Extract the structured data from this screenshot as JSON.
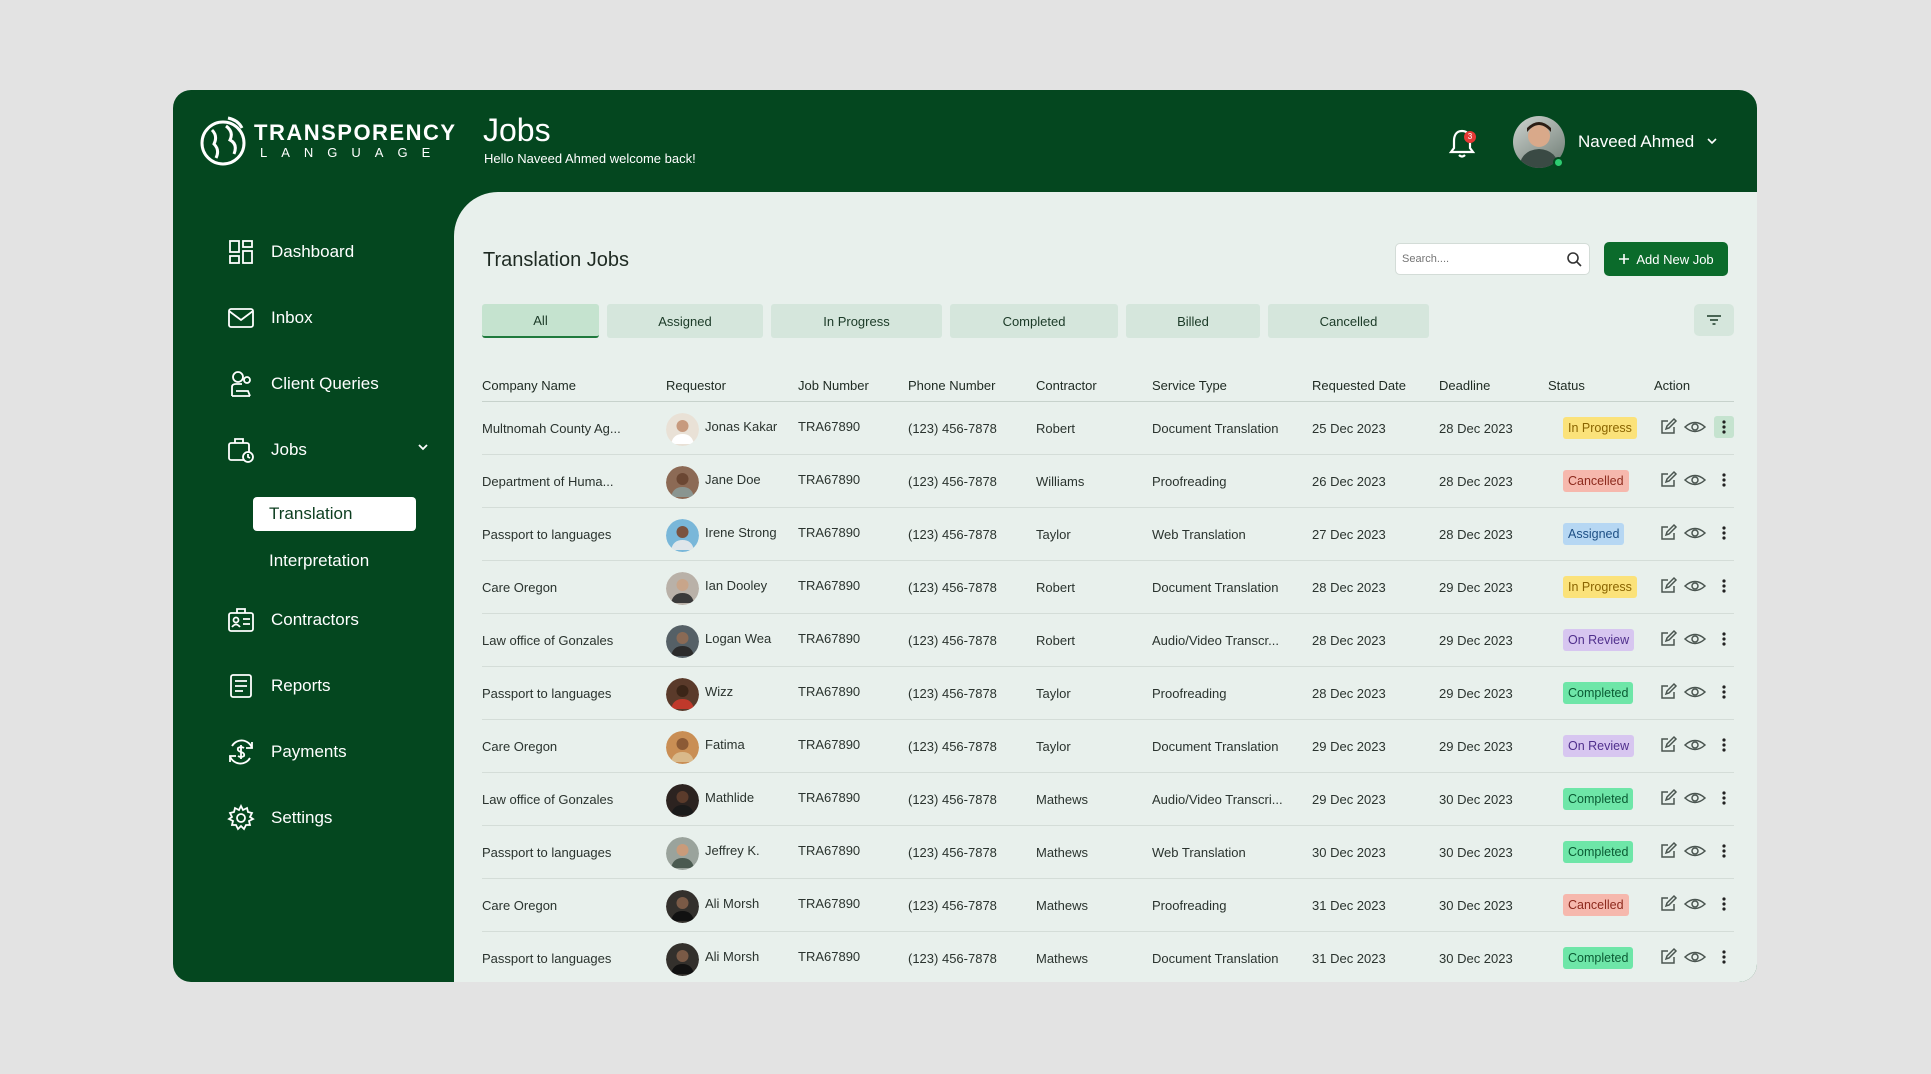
{
  "brand": {
    "name_top": "TRANSPORENCY",
    "name_bottom": "LANGUAGE"
  },
  "header": {
    "title": "Jobs",
    "welcome": "Hello Naveed Ahmed welcome back!",
    "notification_count": "3",
    "user_name": "Naveed Ahmed"
  },
  "sidebar": {
    "items": [
      {
        "label": "Dashboard",
        "icon": "dashboard-icon"
      },
      {
        "label": "Inbox",
        "icon": "mail-icon"
      },
      {
        "label": "Client Queries",
        "icon": "client-queries-icon"
      },
      {
        "label": "Jobs",
        "icon": "jobs-icon"
      },
      {
        "label": "Contractors",
        "icon": "contractors-icon"
      },
      {
        "label": "Reports",
        "icon": "reports-icon"
      },
      {
        "label": "Payments",
        "icon": "payments-icon"
      },
      {
        "label": "Settings",
        "icon": "gear-icon"
      }
    ],
    "jobs_sub": [
      "Translation",
      "Interpretation"
    ]
  },
  "main": {
    "title": "Translation Jobs",
    "search_placeholder": "Search....",
    "add_button": "Add New Job",
    "tabs": [
      "All",
      "Assigned",
      "In Progress",
      "Completed",
      "Billed",
      "Cancelled"
    ],
    "columns": [
      "Company Name",
      "Requestor",
      "Job Number",
      "Phone Number",
      "Contractor",
      "Service Type",
      "Requested Date",
      "Deadline",
      "Status",
      "Action"
    ],
    "rows": [
      {
        "company": "Multnomah County Ag...",
        "requestor": "Jonas Kakar",
        "job": "TRA67890",
        "phone": "(123) 456-7878",
        "contractor": "Robert",
        "service": "Document Translation",
        "requested": "25 Dec 2023",
        "deadline": "28 Dec 2023",
        "status": "In Progress"
      },
      {
        "company": "Department of Huma...",
        "requestor": "Jane Doe",
        "job": "TRA67890",
        "phone": "(123) 456-7878",
        "contractor": "Williams",
        "service": "Proofreading",
        "requested": "26 Dec 2023",
        "deadline": "28 Dec 2023",
        "status": "Cancelled"
      },
      {
        "company": "Passport to languages",
        "requestor": "Irene Strong",
        "job": "TRA67890",
        "phone": "(123) 456-7878",
        "contractor": "Taylor",
        "service": "Web Translation",
        "requested": "27 Dec 2023",
        "deadline": "28 Dec 2023",
        "status": "Assigned"
      },
      {
        "company": "Care Oregon",
        "requestor": "Ian Dooley",
        "job": "TRA67890",
        "phone": "(123) 456-7878",
        "contractor": "Robert",
        "service": "Document Translation",
        "requested": "28 Dec 2023",
        "deadline": "29 Dec 2023",
        "status": "In Progress"
      },
      {
        "company": "Law office of Gonzales",
        "requestor": "Logan Wea",
        "job": "TRA67890",
        "phone": "(123) 456-7878",
        "contractor": "Robert",
        "service": "Audio/Video Transcr...",
        "requested": "28 Dec 2023",
        "deadline": "29 Dec 2023",
        "status": "On Review"
      },
      {
        "company": "Passport to languages",
        "requestor": "Wizz",
        "job": "TRA67890",
        "phone": "(123) 456-7878",
        "contractor": "Taylor",
        "service": "Proofreading",
        "requested": "28 Dec 2023",
        "deadline": "29 Dec 2023",
        "status": "Completed"
      },
      {
        "company": "Care Oregon",
        "requestor": "Fatima",
        "job": "TRA67890",
        "phone": "(123) 456-7878",
        "contractor": "Taylor",
        "service": "Document Translation",
        "requested": "29 Dec 2023",
        "deadline": "29 Dec 2023",
        "status": "On Review"
      },
      {
        "company": "Law office of Gonzales",
        "requestor": "Mathlide",
        "job": "TRA67890",
        "phone": "(123) 456-7878",
        "contractor": "Mathews",
        "service": "Audio/Video Transcri...",
        "requested": "29 Dec 2023",
        "deadline": "30 Dec 2023",
        "status": "Completed"
      },
      {
        "company": "Passport to languages",
        "requestor": "Jeffrey K.",
        "job": "TRA67890",
        "phone": "(123) 456-7878",
        "contractor": "Mathews",
        "service": "Web Translation",
        "requested": "30 Dec 2023",
        "deadline": "30 Dec 2023",
        "status": "Completed"
      },
      {
        "company": "Care Oregon",
        "requestor": "Ali Morsh",
        "job": "TRA67890",
        "phone": "(123) 456-7878",
        "contractor": "Mathews",
        "service": "Proofreading",
        "requested": "31 Dec 2023",
        "deadline": "30 Dec 2023",
        "status": "Cancelled"
      },
      {
        "company": "Passport to languages",
        "requestor": "Ali Morsh",
        "job": "TRA67890",
        "phone": "(123) 456-7878",
        "contractor": "Mathews",
        "service": "Document Translation",
        "requested": "31 Dec 2023",
        "deadline": "30 Dec 2023",
        "status": "Completed"
      }
    ]
  },
  "colors": {
    "brand_green": "#04471f",
    "accent_button": "#0b6b2b",
    "status_in_progress": "#fbe27a",
    "status_cancelled": "#f6b8ad",
    "status_assigned": "#b6d7f3",
    "status_on_review": "#d7c6f0",
    "status_completed": "#6ee6a8"
  }
}
